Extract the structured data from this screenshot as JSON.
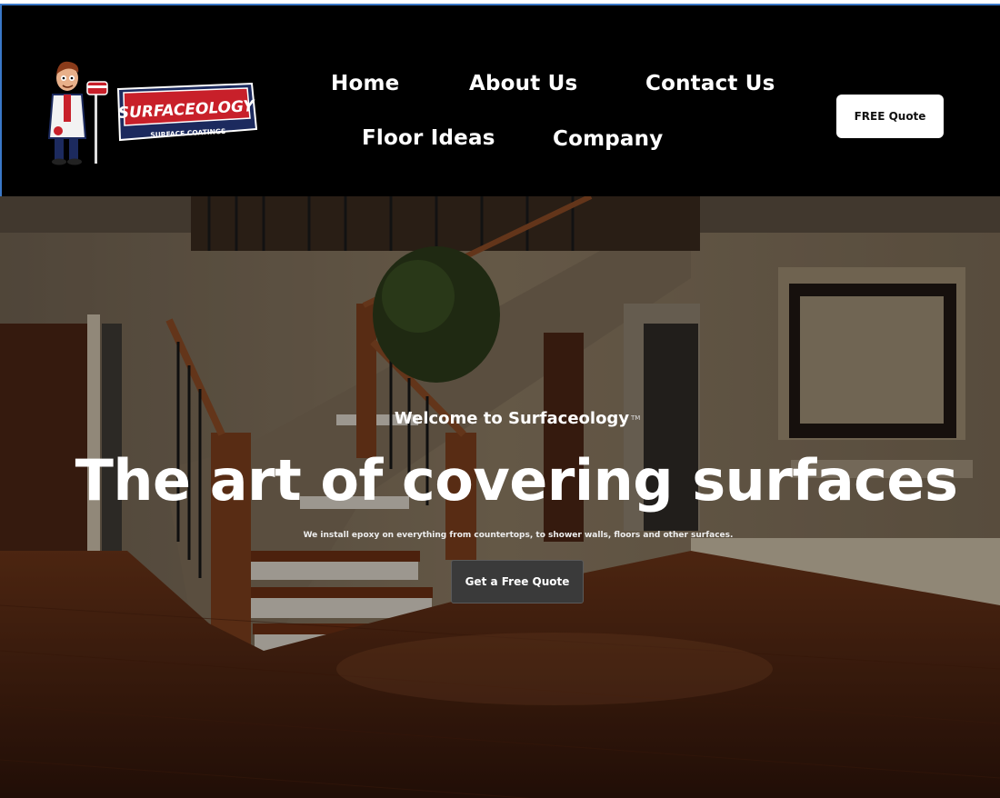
{
  "brand": {
    "logo_text": "SURFACEOLOGY",
    "logo_subtext": "SURFACE COATINGS"
  },
  "nav": {
    "items": [
      {
        "label": "Home"
      },
      {
        "label": "About Us"
      },
      {
        "label": "Contact Us"
      },
      {
        "label": "Floor Ideas"
      },
      {
        "label": "Company"
      }
    ],
    "cta_label": "FREE Quote"
  },
  "hero": {
    "welcome": "Welcome to Surfaceology",
    "trademark": "TM",
    "headline": "The art of covering surfaces",
    "subtext": "We install epoxy on everything from countertops, to shower walls, floors and other surfaces.",
    "button_label": "Get a Free Quote"
  },
  "colors": {
    "header_bg": "#000000",
    "logo_red": "#c8202a",
    "logo_navy": "#1c2a5e",
    "cta_bg": "#3a3a3a"
  }
}
